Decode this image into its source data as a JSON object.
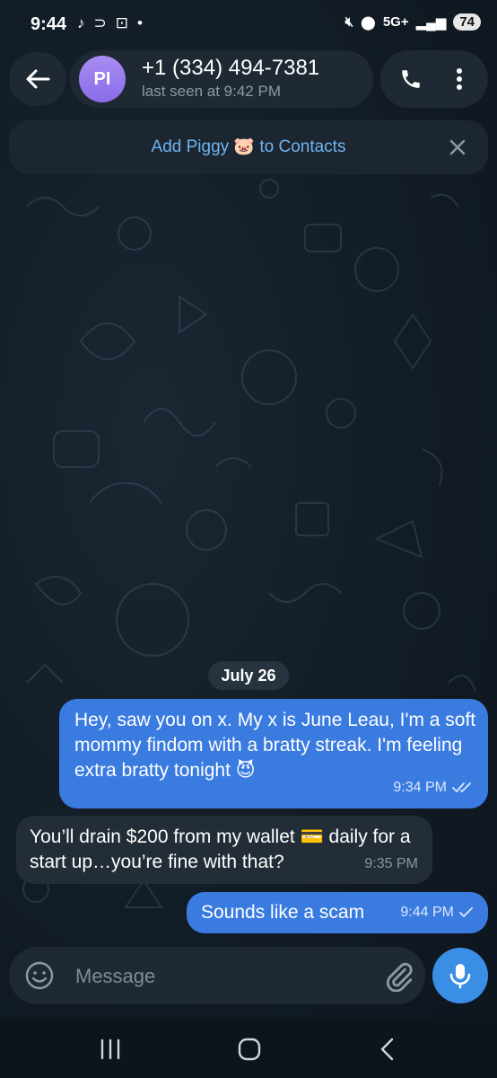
{
  "status_bar": {
    "time": "9:44",
    "left_icons": [
      "tiktok-icon",
      "link-icon",
      "screenshot-icon",
      "dot-icon"
    ],
    "network": "5G+",
    "battery": "74"
  },
  "header": {
    "avatar_initials": "PI",
    "contact_name": "+1 (334) 494-7381",
    "last_seen": "last seen at 9:42 PM"
  },
  "banner": {
    "add_contact_text": "Add Piggy 🐷 to Contacts"
  },
  "chat": {
    "date": "July 26",
    "messages": [
      {
        "direction": "outgoing",
        "text": "Hey, saw you on x. My x is June Leau, I'm a soft mommy findom with a bratty streak. I'm feeling extra bratty tonight 😈",
        "time": "9:34 PM",
        "status": "read"
      },
      {
        "direction": "incoming",
        "text": "You’ll drain $200 from my wallet 💳 daily for a start up…you’re fine with that?",
        "time": "9:35 PM"
      },
      {
        "direction": "outgoing",
        "text": "Sounds like a scam",
        "time": "9:44 PM",
        "status": "sent"
      }
    ]
  },
  "composer": {
    "placeholder": "Message"
  },
  "colors": {
    "outgoing_bubble": "#3a7be0",
    "incoming_bubble": "#222d38",
    "accent_link": "#6fb4ee",
    "mic_button": "#3a8ee6",
    "avatar": "#9a7cee"
  }
}
